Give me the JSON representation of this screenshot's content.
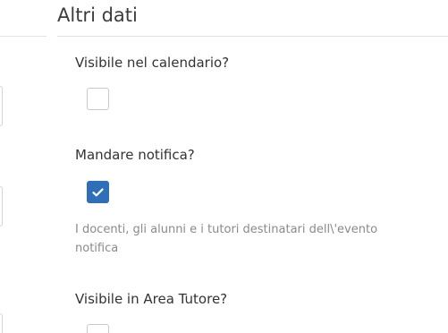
{
  "section": {
    "title": "Altri dati"
  },
  "fields": {
    "visible_calendar": {
      "label": "Visibile nel calendario?",
      "checked": false
    },
    "send_notification": {
      "label": "Mandare notifica?",
      "checked": true,
      "help_line_1": "I docenti, gli alunni e i tutori destinatari dell\\'evento",
      "help_line_2": "notifica"
    },
    "visible_tutor_area": {
      "label": "Visibile in Area Tutore?",
      "checked": false
    }
  },
  "colors": {
    "accent": "#2e6fb7",
    "help_text": "#8a8a8a"
  }
}
